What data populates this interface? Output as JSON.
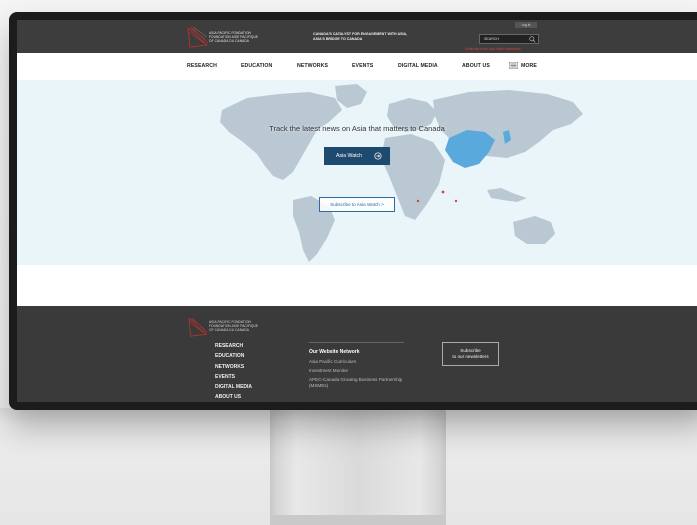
{
  "header": {
    "logo_text": "ASIA PACIFIC    FONDATION\nFOUNDATION    ASIE PACIFIQUE\nOF CANADA      DU CANADA",
    "tagline": "CANADA'S CATALYST FOR ENGAGEMENT WITH ASIA,\nASIA'S BRIDGE TO CANADA",
    "login_label": "Log In",
    "search_placeholder": "SEARCH",
    "newsletter_link": "Subscribe to the Asia Watch Newsletter"
  },
  "nav": {
    "items": [
      "RESEARCH",
      "EDUCATION",
      "NETWORKS",
      "EVENTS",
      "DIGITAL MEDIA",
      "ABOUT US"
    ],
    "more_label": "MORE"
  },
  "hero": {
    "title": "Track the latest news on Asia that matters to Canada",
    "primary_button": "Asia Watch",
    "secondary_button": "Subscribe to Asia Watch  >"
  },
  "footer": {
    "logo_text": "ASIA PACIFIC    FONDATION\nFOUNDATION    ASIE PACIFIQUE\nOF CANADA      DU CANADA",
    "links": [
      "RESEARCH",
      "EDUCATION",
      "NETWORKS",
      "EVENTS",
      "DIGITAL MEDIA",
      "ABOUT US"
    ],
    "network_title": "Our Website Network",
    "network_links": [
      "Asia Pacific Curriculum",
      "Investment Monitor",
      "APEC-Canada Growing Business Partnership (MSMEs)"
    ],
    "subscribe_button": "Subscribe\nto our newsletters"
  },
  "colors": {
    "header_bg": "#3d3d3d",
    "hero_bg": "#e9f5f9",
    "map_land": "#b9c8d3",
    "map_highlight": "#5aa9dc",
    "primary_button": "#1f4a70",
    "accent_red": "#d8413d",
    "footer_bg": "#3a3a3a"
  },
  "icons": {
    "logo": "logo-mark-icon",
    "search": "search-icon",
    "menu": "hamburger-menu-icon",
    "button_arrow": "circle-arrow-icon"
  }
}
